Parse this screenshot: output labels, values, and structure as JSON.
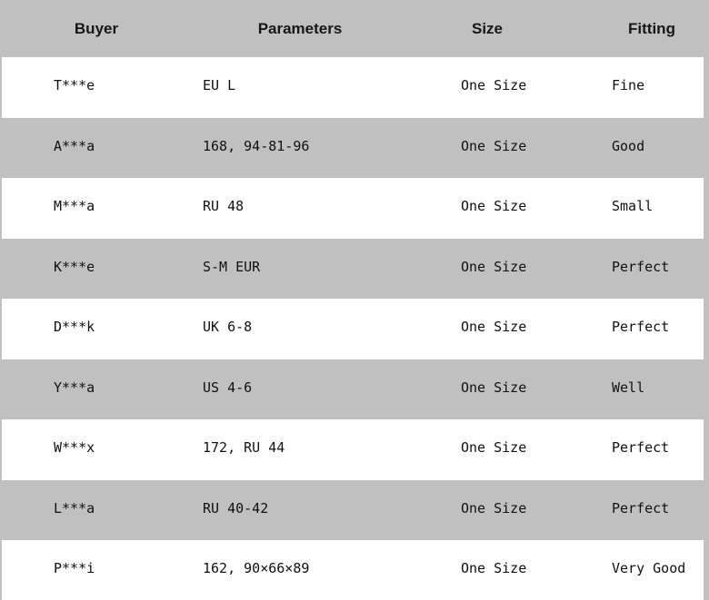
{
  "table": {
    "columns": [
      {
        "key": "buyer",
        "label": "Buyer"
      },
      {
        "key": "parameters",
        "label": "Parameters"
      },
      {
        "key": "size",
        "label": "Size"
      },
      {
        "key": "fitting",
        "label": "Fitting"
      }
    ],
    "header_background": "#c0c0c0",
    "row_background_odd": "#ffffff",
    "row_background_even": "#c0c0c0",
    "text_color": "#111111",
    "row_count": 9,
    "rows": [
      {
        "buyer": "T***e",
        "parameters": "EU L",
        "size": "One Size",
        "fitting": "Fine"
      },
      {
        "buyer": "A***a",
        "parameters": "168, 94-81-96",
        "size": "One Size",
        "fitting": "Good"
      },
      {
        "buyer": "M***a",
        "parameters": "RU 48",
        "size": "One Size",
        "fitting": "Small"
      },
      {
        "buyer": "K***e",
        "parameters": "S-M EUR",
        "size": "One Size",
        "fitting": "Perfect"
      },
      {
        "buyer": "D***k",
        "parameters": "UK 6-8",
        "size": "One Size",
        "fitting": "Perfect"
      },
      {
        "buyer": "Y***a",
        "parameters": "US 4-6",
        "size": "One Size",
        "fitting": "Well"
      },
      {
        "buyer": "W***x",
        "parameters": "172, RU 44",
        "size": "One Size",
        "fitting": "Perfect"
      },
      {
        "buyer": "L***a",
        "parameters": "RU 40-42",
        "size": "One Size",
        "fitting": "Perfect"
      },
      {
        "buyer": "P***i",
        "parameters": "162, 90×66×89",
        "size": "One Size",
        "fitting": "Very Good"
      }
    ]
  }
}
